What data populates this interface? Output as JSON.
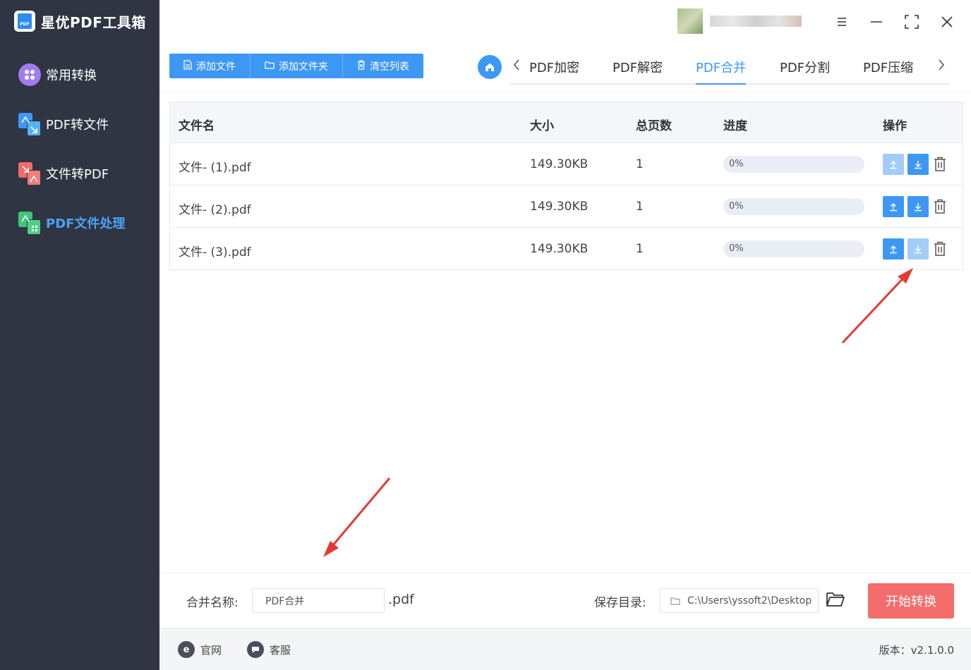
{
  "app": {
    "name": "星优PDF工具箱",
    "logo_text": "PDF"
  },
  "sidebar": {
    "items": [
      {
        "label": "常用转换",
        "icon": "apps-icon"
      },
      {
        "label": "PDF转文件",
        "icon": "pdf-to-file-icon"
      },
      {
        "label": "文件转PDF",
        "icon": "file-to-pdf-icon"
      },
      {
        "label": "PDF文件处理",
        "icon": "pdf-process-icon"
      }
    ],
    "active_index": 3
  },
  "toolbar": {
    "add_file": "添加文件",
    "add_folder": "添加文件夹",
    "clear_list": "清空列表"
  },
  "tabs": {
    "items": [
      "PDF加密",
      "PDF解密",
      "PDF合并",
      "PDF分割",
      "PDF压缩"
    ],
    "active": "PDF合并"
  },
  "table": {
    "headers": {
      "name": "文件名",
      "size": "大小",
      "pages": "总页数",
      "progress": "进度",
      "actions": "操作"
    },
    "rows": [
      {
        "name": "文件- (1).pdf",
        "size": "149.30KB",
        "pages": "1",
        "progress": 0,
        "progress_text": "0%",
        "up_enabled": false,
        "down_enabled": true
      },
      {
        "name": "文件- (2).pdf",
        "size": "149.30KB",
        "pages": "1",
        "progress": 0,
        "progress_text": "0%",
        "up_enabled": true,
        "down_enabled": true
      },
      {
        "name": "文件- (3).pdf",
        "size": "149.30KB",
        "pages": "1",
        "progress": 0,
        "progress_text": "0%",
        "up_enabled": true,
        "down_enabled": false
      }
    ]
  },
  "bottom": {
    "merge_label": "合并名称:",
    "merge_value": "PDF合并",
    "merge_ext": ".pdf",
    "save_label": "保存目录:",
    "save_path": "C:\\Users\\yssoft2\\Desktop",
    "start_button": "开始转换"
  },
  "footer": {
    "website": "官网",
    "support": "客服",
    "version": "版本：v2.1.0.0"
  },
  "colors": {
    "sidebar_bg": "#2f3542",
    "accent": "#3d98f5",
    "start_button": "#f56c6c",
    "annotation_arrow": "#e53935"
  }
}
